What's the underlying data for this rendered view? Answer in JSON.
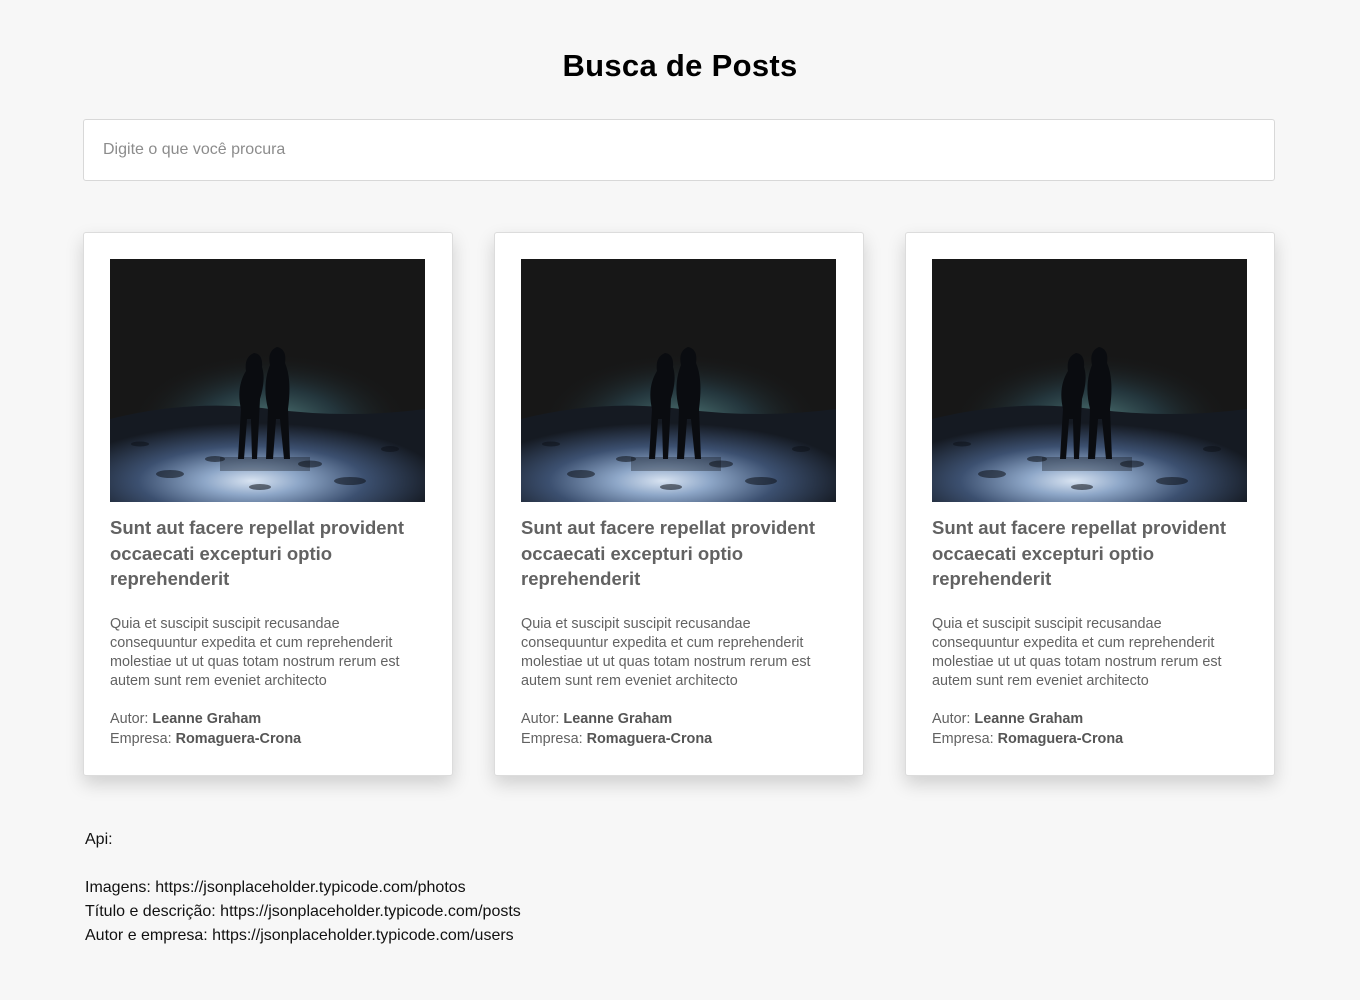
{
  "header": {
    "title": "Busca de Posts"
  },
  "search": {
    "placeholder": "Digite o que você procura",
    "value": ""
  },
  "posts": [
    {
      "image_alt": "Silhueta de casal na praia à noite",
      "title": "Sunt aut facere repellat provident occaecati excepturi optio reprehenderit",
      "body": "Quia et suscipit suscipit recusandae consequuntur expedita et cum reprehenderit molestiae ut ut quas totam nostrum rerum est autem sunt rem eveniet architecto",
      "author_label": "Autor:",
      "author": "Leanne Graham",
      "company_label": "Empresa:",
      "company": "Romaguera-Crona"
    },
    {
      "image_alt": "Silhueta de casal na praia à noite",
      "title": "Sunt aut facere repellat provident occaecati excepturi optio reprehenderit",
      "body": "Quia et suscipit suscipit recusandae consequuntur expedita et cum reprehenderit molestiae ut ut quas totam nostrum rerum est autem sunt rem eveniet architecto",
      "author_label": "Autor:",
      "author": "Leanne Graham",
      "company_label": "Empresa:",
      "company": "Romaguera-Crona"
    },
    {
      "image_alt": "Silhueta de casal na praia à noite",
      "title": "Sunt aut facere repellat provident occaecati excepturi optio reprehenderit",
      "body": "Quia et suscipit suscipit recusandae consequuntur expedita et cum reprehenderit molestiae ut ut quas totam nostrum rerum est autem sunt rem eveniet architecto",
      "author_label": "Autor:",
      "author": "Leanne Graham",
      "company_label": "Empresa:",
      "company": "Romaguera-Crona"
    }
  ],
  "api": {
    "heading": "Api:",
    "lines": [
      "Imagens: https://jsonplaceholder.typicode.com/photos",
      "Título e descrição: https://jsonplaceholder.typicode.com/posts",
      "Autor e empresa: https://jsonplaceholder.typicode.com/users"
    ]
  },
  "colors": {
    "page_background": "#f7f7f7",
    "card_background": "#ffffff",
    "card_text": "#626262",
    "image_dark": "#171717",
    "image_sand": "#8ea7c8"
  }
}
